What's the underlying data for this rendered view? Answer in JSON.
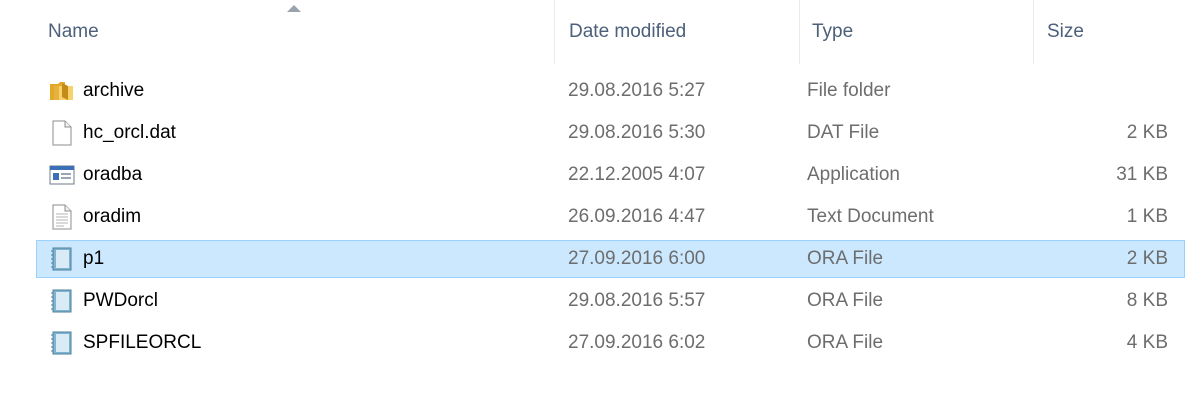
{
  "columns": {
    "name": "Name",
    "date_modified": "Date modified",
    "type": "Type",
    "size": "Size"
  },
  "sort": {
    "column": "name",
    "direction": "ascending"
  },
  "files": [
    {
      "name": "archive",
      "date": "29.08.2016 5:27",
      "type": "File folder",
      "size": "",
      "icon": "folder-icon",
      "selected": false
    },
    {
      "name": "hc_orcl.dat",
      "date": "29.08.2016 5:30",
      "type": "DAT File",
      "size": "2 KB",
      "icon": "blank-file-icon",
      "selected": false
    },
    {
      "name": "oradba",
      "date": "22.12.2005 4:07",
      "type": "Application",
      "size": "31 KB",
      "icon": "application-icon",
      "selected": false
    },
    {
      "name": "oradim",
      "date": "26.09.2016 4:47",
      "type": "Text Document",
      "size": "1 KB",
      "icon": "text-document-icon",
      "selected": false
    },
    {
      "name": "p1",
      "date": "27.09.2016 6:00",
      "type": "ORA File",
      "size": "2 KB",
      "icon": "ora-file-icon",
      "selected": true
    },
    {
      "name": "PWDorcl",
      "date": "29.08.2016 5:57",
      "type": "ORA File",
      "size": "8 KB",
      "icon": "ora-file-icon",
      "selected": false
    },
    {
      "name": "SPFILEORCL",
      "date": "27.09.2016 6:02",
      "type": "ORA File",
      "size": "4 KB",
      "icon": "ora-file-icon",
      "selected": false
    }
  ],
  "colors": {
    "header_text": "#4c607a",
    "secondary_text": "#6d6d6d",
    "selection_fill": "#cce8ff",
    "selection_border": "#99d1ff"
  }
}
